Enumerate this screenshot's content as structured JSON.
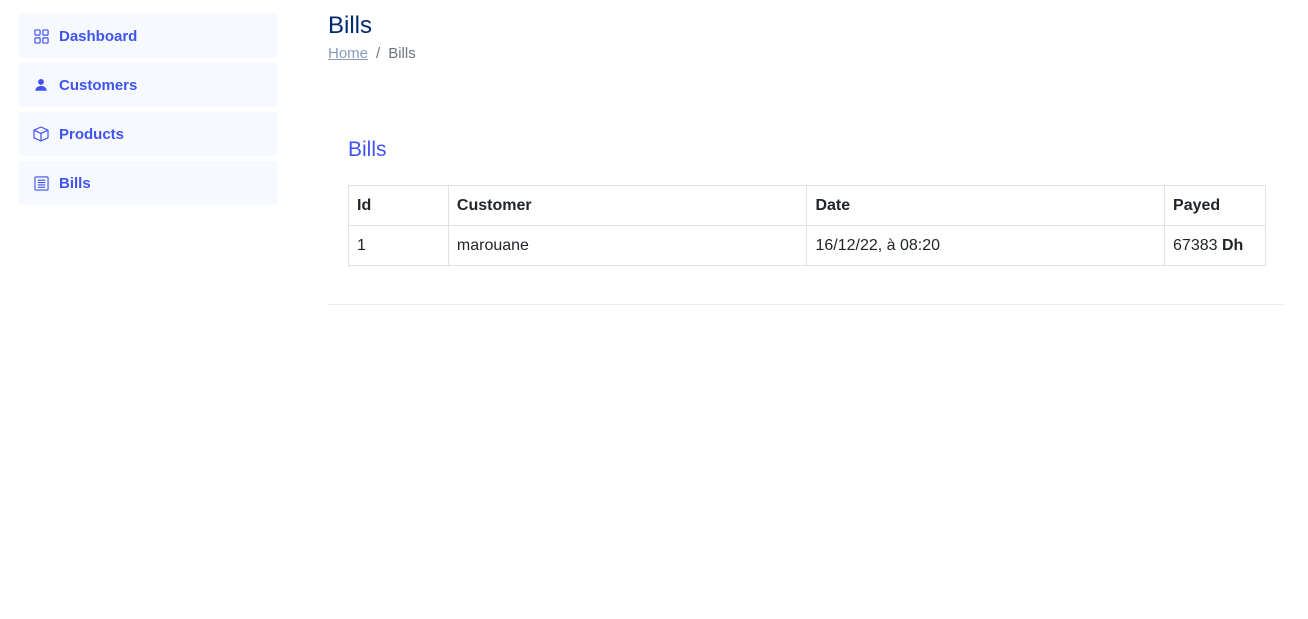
{
  "sidebar": {
    "items": [
      {
        "label": "Dashboard",
        "icon": "grid-icon"
      },
      {
        "label": "Customers",
        "icon": "person-icon"
      },
      {
        "label": "Products",
        "icon": "box-icon"
      },
      {
        "label": "Bills",
        "icon": "layout-text-icon"
      }
    ]
  },
  "header": {
    "title": "Bills",
    "breadcrumb": {
      "home": "Home",
      "separator": "/",
      "current": "Bills"
    }
  },
  "card": {
    "title": "Bills",
    "table": {
      "columns": [
        "Id",
        "Customer",
        "Date",
        "Payed"
      ],
      "rows": [
        {
          "id": "1",
          "customer": "marouane",
          "date": "16/12/22, à 08:20",
          "amount": "67383",
          "currency": "Dh"
        }
      ]
    }
  },
  "colors": {
    "accent": "#4154f1",
    "title": "#012970"
  }
}
